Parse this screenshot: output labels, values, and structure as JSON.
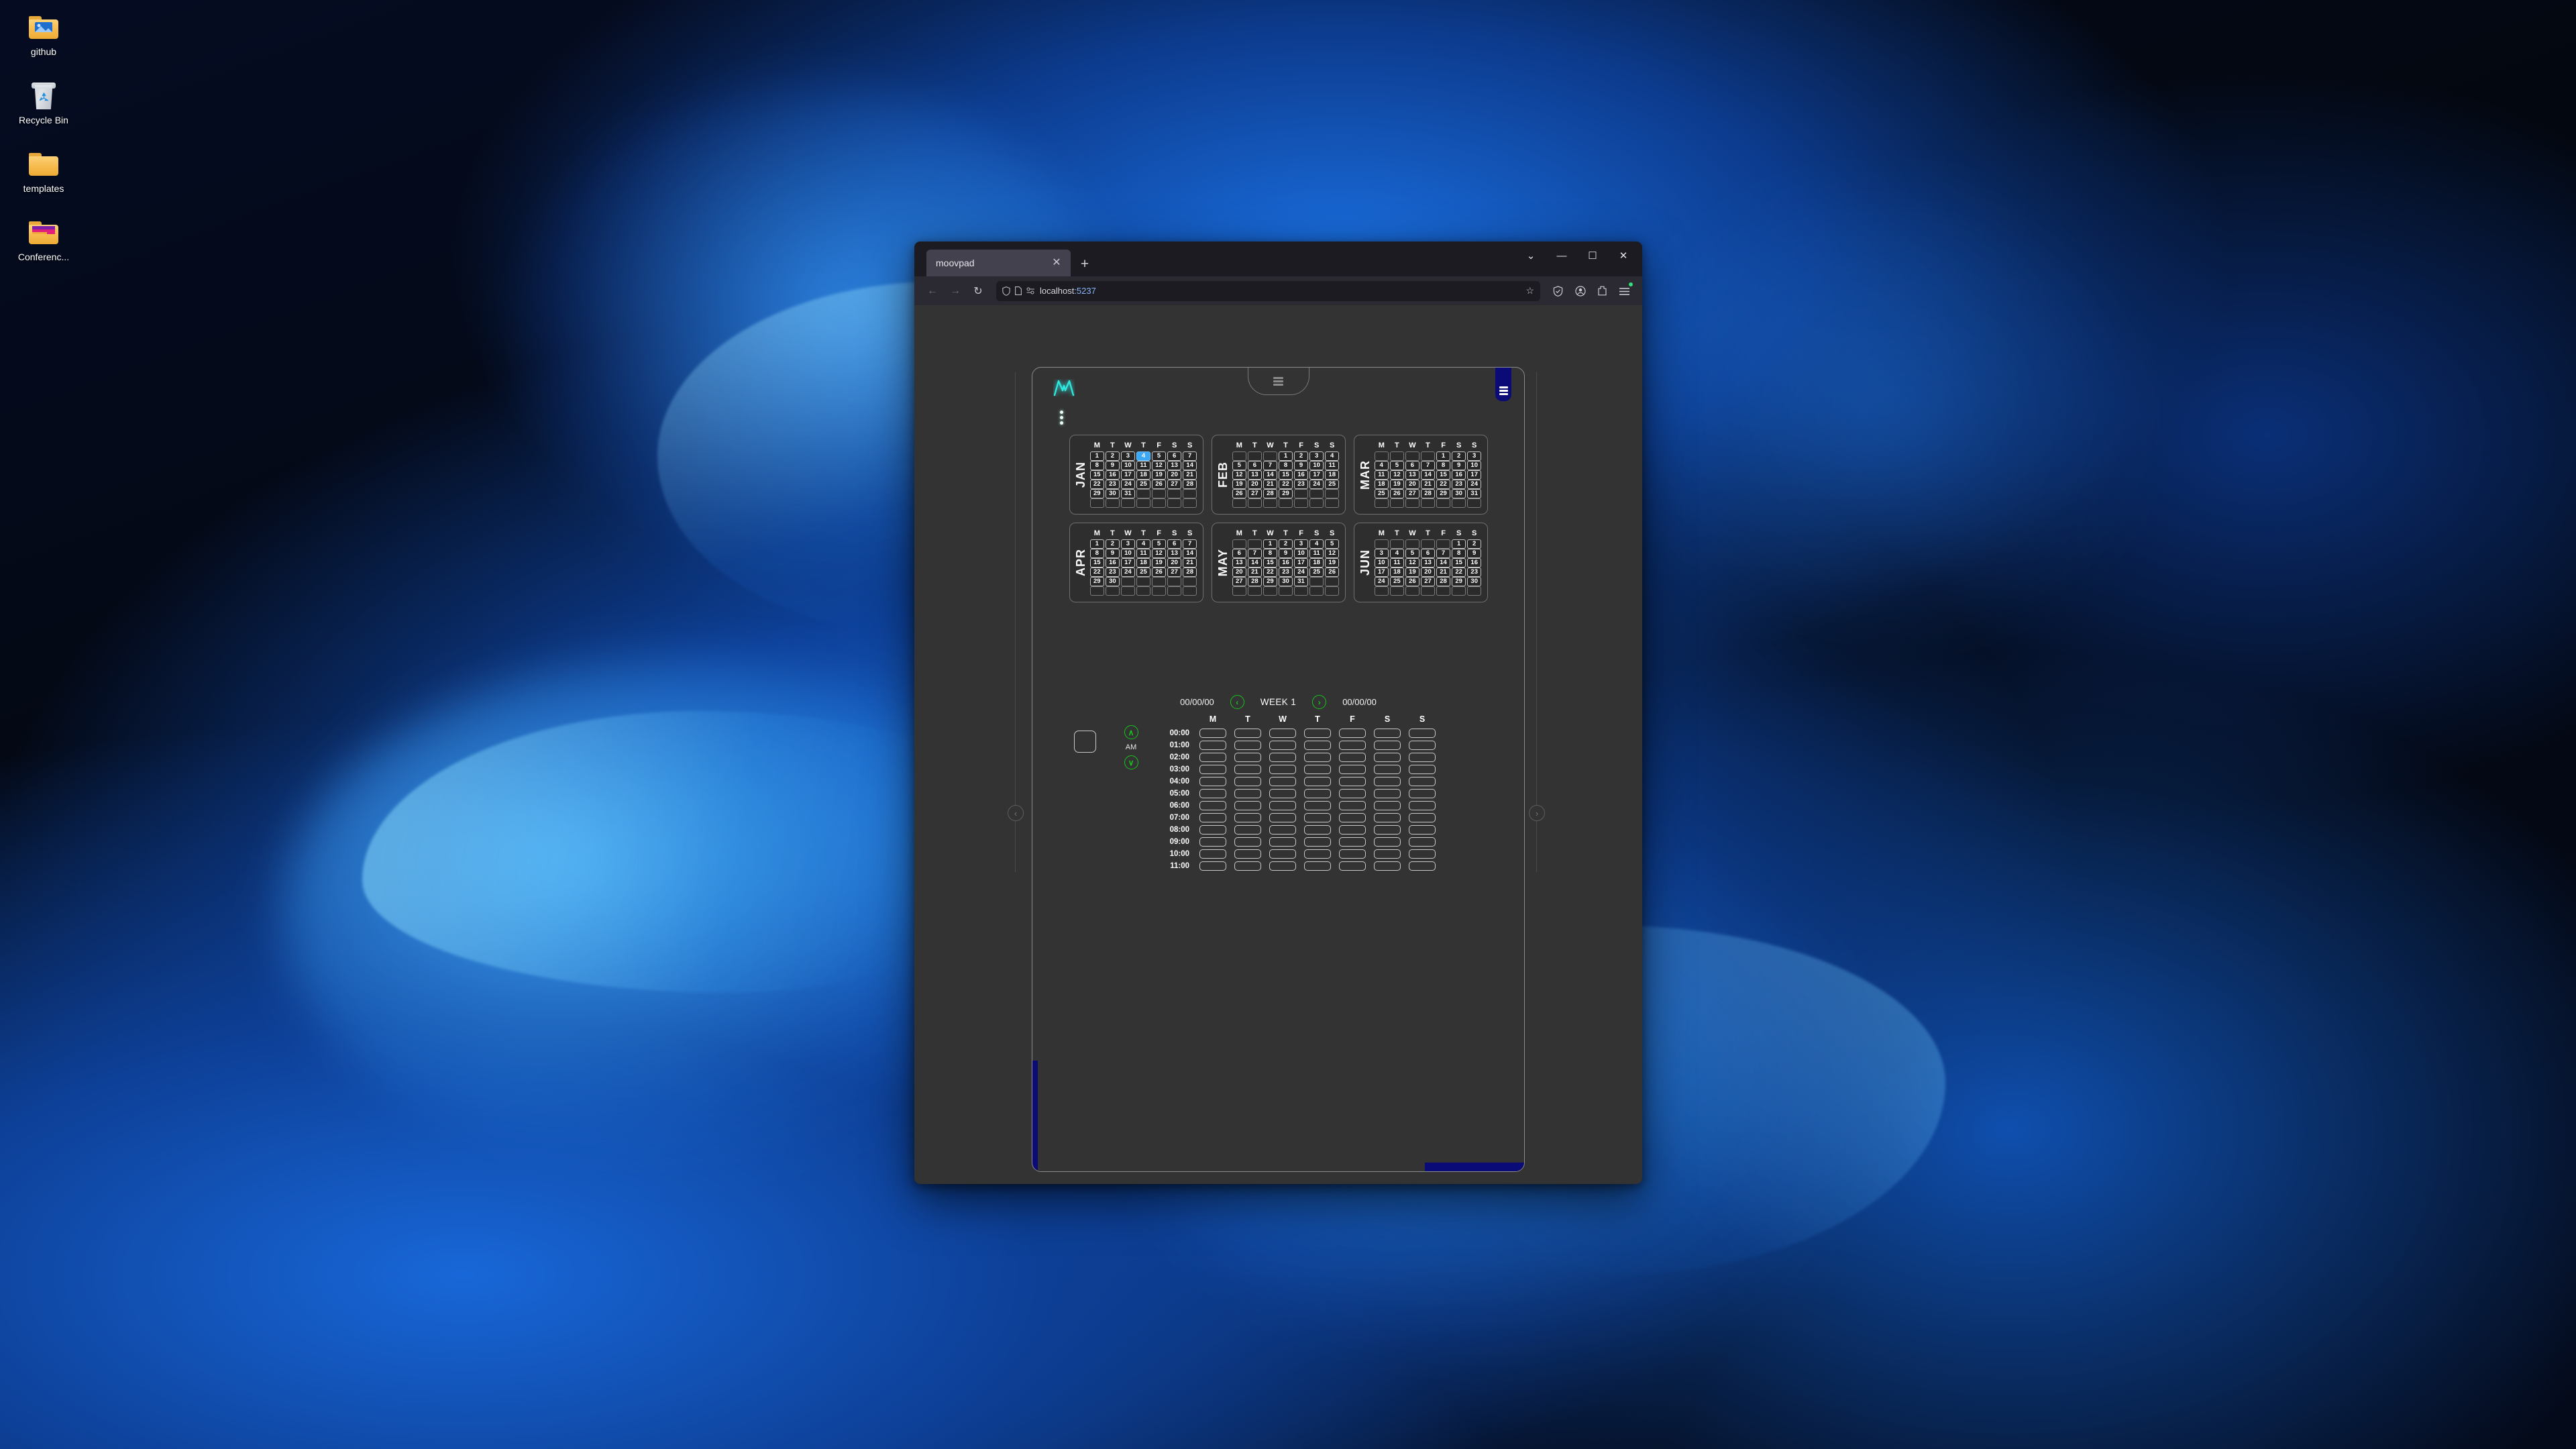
{
  "desktop": {
    "icons": [
      {
        "name": "github",
        "label": "github",
        "type": "folder-image"
      },
      {
        "name": "recycle-bin",
        "label": "Recycle Bin",
        "type": "bin"
      },
      {
        "name": "templates",
        "label": "templates",
        "type": "folder"
      },
      {
        "name": "conference",
        "label": "Conferenc...",
        "type": "folder-media"
      }
    ]
  },
  "browser": {
    "tab": {
      "title": "moovpad",
      "close_label": "✕"
    },
    "new_tab_label": "+",
    "window_controls": {
      "tab_list": "⌄",
      "minimize": "—",
      "maximize": "☐",
      "close": "✕"
    },
    "nav": {
      "back": "←",
      "forward": "→",
      "reload": "↻"
    },
    "url": {
      "host": "localhost",
      "port": ":5237",
      "star": "☆"
    },
    "toolbar_icons": [
      "shield-icon",
      "account-icon",
      "extensions-icon",
      "app-menu-icon"
    ]
  },
  "app": {
    "logo": "moovpad-logo",
    "pull_tab": "menu-tab",
    "side_toggle": "sidebar-toggle",
    "prev_arrow": "‹",
    "next_arrow": "›",
    "months": [
      {
        "abbr": "JAN",
        "dow": [
          "M",
          "T",
          "W",
          "T",
          "F",
          "S",
          "S"
        ],
        "lead_blanks": 0,
        "days": 31,
        "selected": 4
      },
      {
        "abbr": "FEB",
        "dow": [
          "M",
          "T",
          "W",
          "T",
          "F",
          "S",
          "S"
        ],
        "lead_blanks": 3,
        "days": 29,
        "selected": null
      },
      {
        "abbr": "MAR",
        "dow": [
          "M",
          "T",
          "W",
          "T",
          "F",
          "S",
          "S"
        ],
        "lead_blanks": 4,
        "days": 31,
        "selected": null
      },
      {
        "abbr": "APR",
        "dow": [
          "M",
          "T",
          "W",
          "T",
          "F",
          "S",
          "S"
        ],
        "lead_blanks": 0,
        "days": 30,
        "selected": null
      },
      {
        "abbr": "MAY",
        "dow": [
          "M",
          "T",
          "W",
          "T",
          "F",
          "S",
          "S"
        ],
        "lead_blanks": 2,
        "days": 31,
        "selected": null
      },
      {
        "abbr": "JUN",
        "dow": [
          "M",
          "T",
          "W",
          "T",
          "F",
          "S",
          "S"
        ],
        "lead_blanks": 5,
        "days": 30,
        "selected": null
      }
    ],
    "week": {
      "start_date": "00/00/00",
      "end_date": "00/00/00",
      "label": "WEEK 1",
      "prev_icon": "‹",
      "next_icon": "›",
      "up_icon": "∧",
      "down_icon": "∨",
      "ampm": "AM",
      "day_headers": [
        "M",
        "T",
        "W",
        "T",
        "F",
        "S",
        "S"
      ],
      "hours": [
        "00:00",
        "01:00",
        "02:00",
        "03:00",
        "04:00",
        "05:00",
        "06:00",
        "07:00",
        "08:00",
        "09:00",
        "10:00",
        "11:00"
      ]
    }
  },
  "colors": {
    "accent_navy": "#0b0b78",
    "accent_green": "#18c41c",
    "accent_cyan": "#2ee8e0",
    "selected_day": "#3ba7f5",
    "panel_bg": "#333333"
  }
}
